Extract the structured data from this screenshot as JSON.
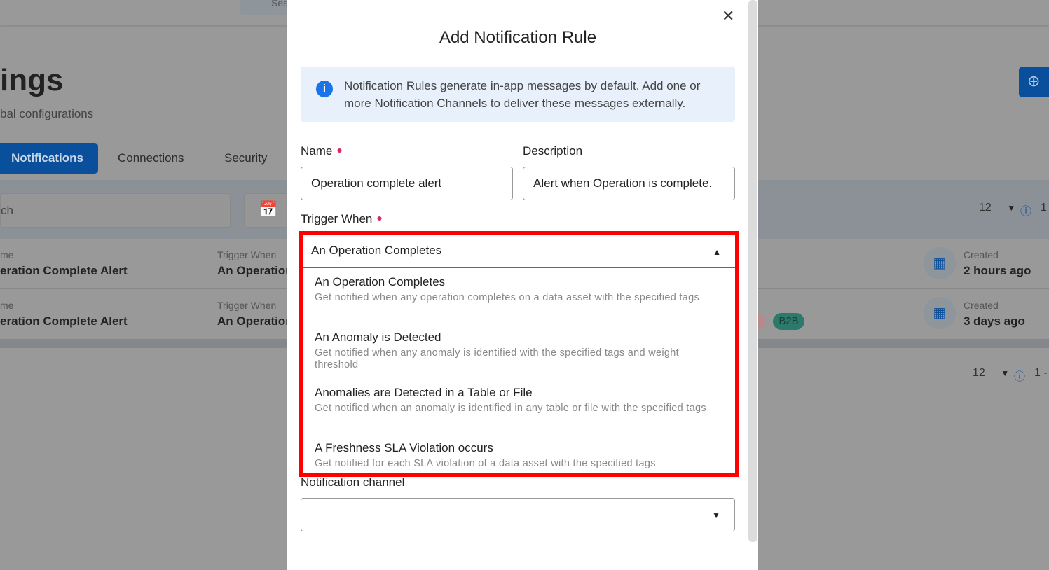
{
  "header": {
    "search_placeholder": "Sea"
  },
  "page": {
    "title": "ings",
    "subtitle": "bal configurations",
    "add_icon": "plus-circle-icon"
  },
  "tabs": [
    {
      "label": "Notifications",
      "active": true
    },
    {
      "label": "Connections"
    },
    {
      "label": "Security"
    }
  ],
  "toolbar": {
    "search_placeholder": "ch",
    "page_size": "12",
    "range": "1"
  },
  "rows": [
    {
      "name_label": "me",
      "name": "eration Complete Alert",
      "trigger_label": "Trigger When",
      "trigger": "An Operation",
      "created_label": "Created",
      "created": "2 hours ago"
    },
    {
      "name_label": "me",
      "name": "eration Complete Alert",
      "trigger_label": "Trigger When",
      "trigger": "An Operation",
      "created_label": "Created",
      "created": "3 days ago",
      "tags": [
        "B2B"
      ]
    }
  ],
  "footer": {
    "page_size": "12",
    "range": "1 -"
  },
  "modal": {
    "title": "Add Notification Rule",
    "info": "Notification Rules generate in-app messages by default. Add one or more Notification Channels to deliver these messages externally.",
    "name_label": "Name",
    "name_value": "Operation complete alert",
    "description_label": "Description",
    "description_value": "Alert when Operation is complete.",
    "trigger_label": "Trigger When",
    "trigger_value": "An Operation Completes",
    "options": [
      {
        "title": "An Operation Completes",
        "desc": "Get notified when any operation completes on a data asset with the specified tags"
      },
      {
        "title": "An Anomaly is Detected",
        "desc": "Get notified when any anomaly is identified with the specified tags and weight threshold"
      },
      {
        "title": "Anomalies are Detected in a Table or File",
        "desc": "Get notified when an anomaly is identified in any table or file with the specified tags"
      },
      {
        "title": "A Freshness SLA Violation occurs",
        "desc": "Get notified for each SLA violation of a data asset with the specified tags"
      }
    ],
    "channel_label": "Notification channel",
    "channel_value": ""
  },
  "colors": {
    "primary": "#0a4f9c",
    "highlight": "#ff0000",
    "required": "#e0245e",
    "info_bg": "#e8f0fb"
  }
}
